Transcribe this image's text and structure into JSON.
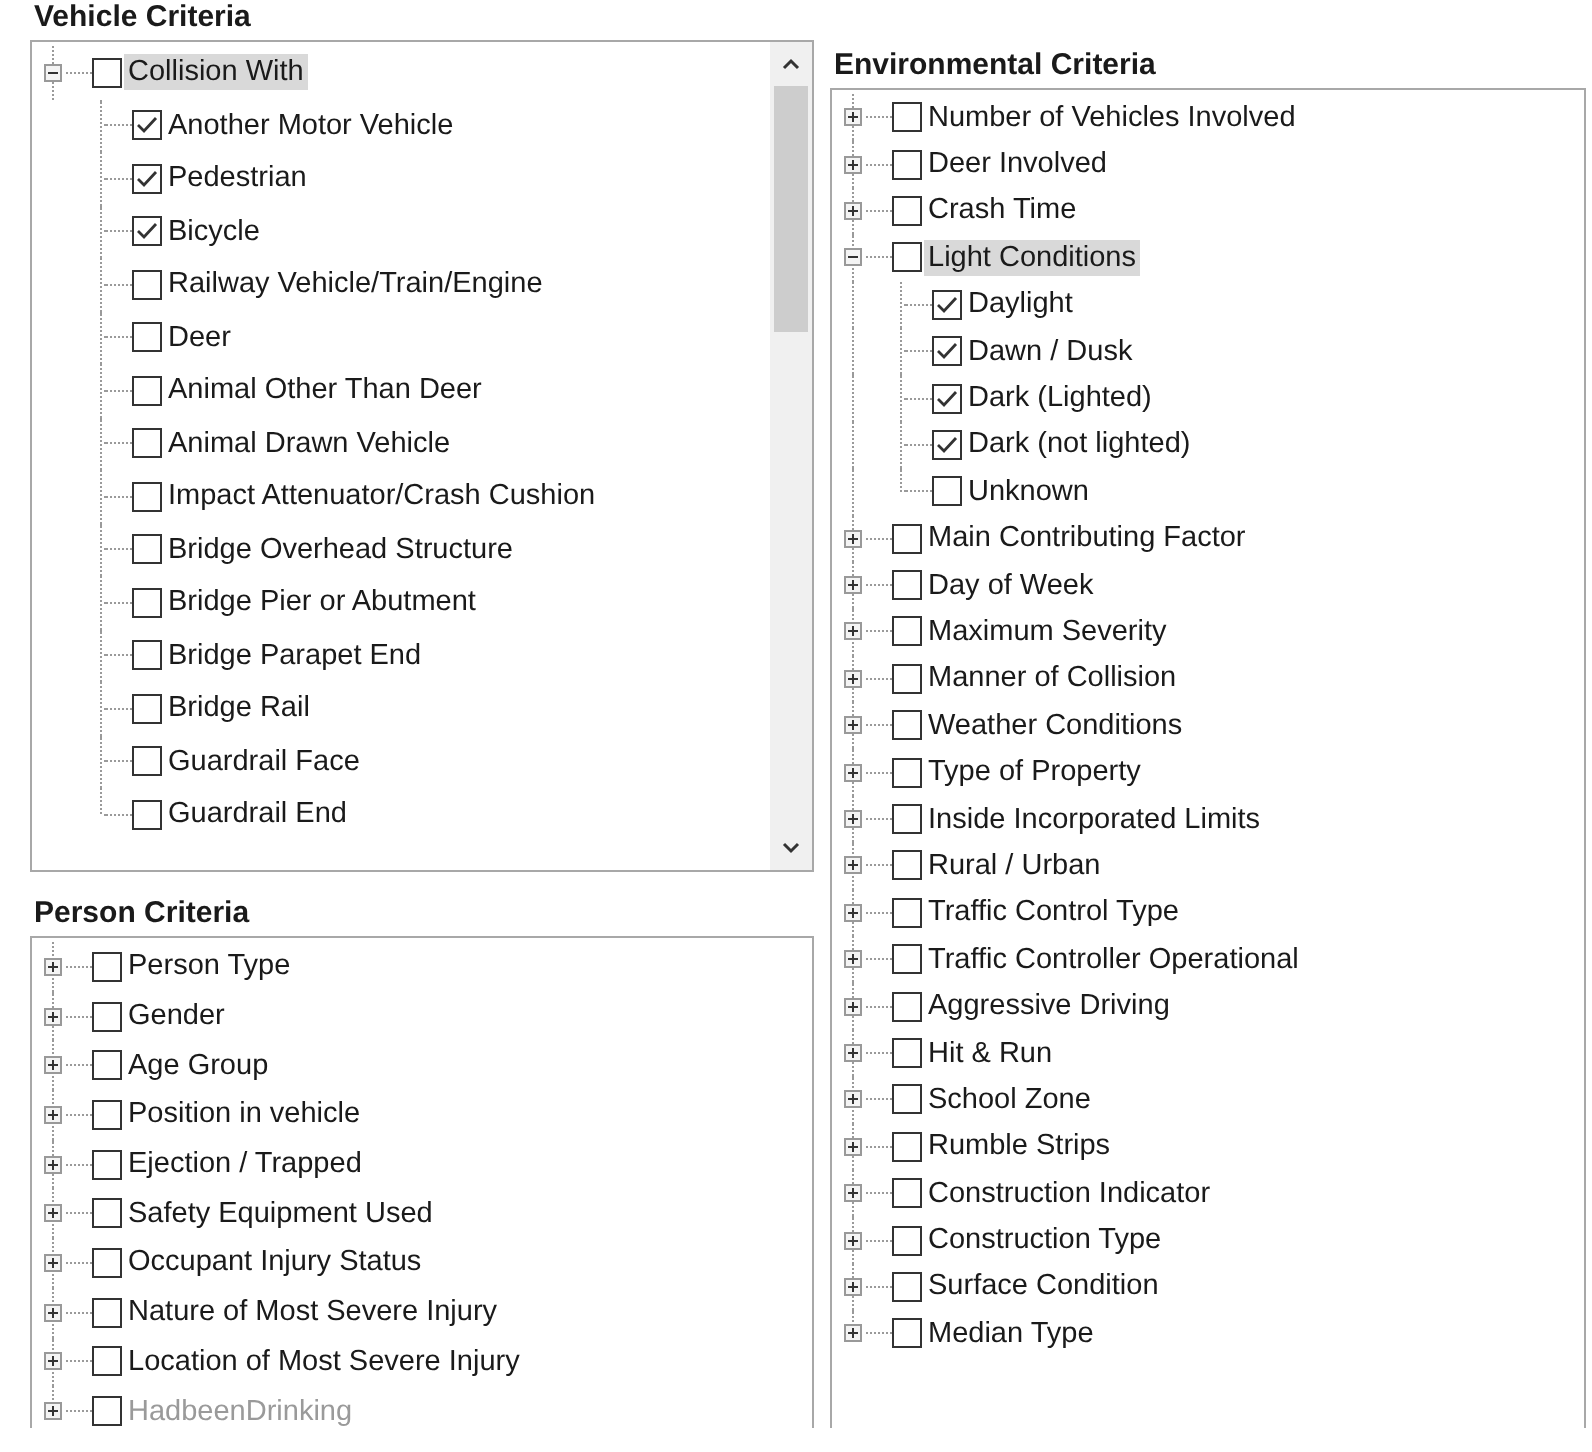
{
  "panels": [
    {
      "title": "Vehicle Criteria",
      "scrollbar": true,
      "items": [
        {
          "label": "Collision With",
          "checked": false,
          "selected": true,
          "expanded": true,
          "disabled": false,
          "children": [
            {
              "label": "Another Motor Vehicle",
              "checked": true
            },
            {
              "label": "Pedestrian",
              "checked": true
            },
            {
              "label": "Bicycle",
              "checked": true
            },
            {
              "label": "Railway Vehicle/Train/Engine",
              "checked": false
            },
            {
              "label": "Deer",
              "checked": false
            },
            {
              "label": "Animal Other Than Deer",
              "checked": false
            },
            {
              "label": "Animal Drawn Vehicle",
              "checked": false
            },
            {
              "label": "Impact Attenuator/Crash Cushion",
              "checked": false
            },
            {
              "label": "Bridge Overhead Structure",
              "checked": false
            },
            {
              "label": "Bridge Pier or Abutment",
              "checked": false
            },
            {
              "label": "Bridge Parapet End",
              "checked": false
            },
            {
              "label": "Bridge Rail",
              "checked": false
            },
            {
              "label": "Guardrail Face",
              "checked": false
            },
            {
              "label": "Guardrail End",
              "checked": false
            }
          ]
        }
      ]
    },
    {
      "title": "Person Criteria",
      "scrollbar": false,
      "items": [
        {
          "label": "Person Type",
          "checked": false,
          "selected": false,
          "expanded": false,
          "disabled": false
        },
        {
          "label": "Gender",
          "checked": false,
          "selected": false,
          "expanded": false,
          "disabled": false
        },
        {
          "label": "Age Group",
          "checked": false,
          "selected": false,
          "expanded": false,
          "disabled": false
        },
        {
          "label": "Position in vehicle",
          "checked": false,
          "selected": false,
          "expanded": false,
          "disabled": false
        },
        {
          "label": "Ejection / Trapped",
          "checked": false,
          "selected": false,
          "expanded": false,
          "disabled": false
        },
        {
          "label": "Safety Equipment Used",
          "checked": false,
          "selected": false,
          "expanded": false,
          "disabled": false
        },
        {
          "label": "Occupant Injury Status",
          "checked": false,
          "selected": false,
          "expanded": false,
          "disabled": false
        },
        {
          "label": "Nature of Most Severe Injury",
          "checked": false,
          "selected": false,
          "expanded": false,
          "disabled": false
        },
        {
          "label": "Location of Most Severe Injury",
          "checked": false,
          "selected": false,
          "expanded": false,
          "disabled": false
        },
        {
          "label": "HadbeenDrinking",
          "checked": false,
          "selected": false,
          "expanded": false,
          "disabled": true
        }
      ]
    },
    {
      "title": "Environmental Criteria",
      "scrollbar": false,
      "items": [
        {
          "label": "Number of Vehicles Involved",
          "checked": false,
          "selected": false,
          "expanded": false,
          "disabled": false
        },
        {
          "label": "Deer Involved",
          "checked": false,
          "selected": false,
          "expanded": false,
          "disabled": false
        },
        {
          "label": "Crash Time",
          "checked": false,
          "selected": false,
          "expanded": false,
          "disabled": false
        },
        {
          "label": "Light Conditions",
          "checked": false,
          "selected": true,
          "expanded": true,
          "disabled": false,
          "children": [
            {
              "label": "Daylight",
              "checked": true
            },
            {
              "label": "Dawn / Dusk",
              "checked": true
            },
            {
              "label": "Dark (Lighted)",
              "checked": true
            },
            {
              "label": "Dark (not lighted)",
              "checked": true
            },
            {
              "label": "Unknown",
              "checked": false
            }
          ]
        },
        {
          "label": "Main Contributing Factor",
          "checked": false,
          "selected": false,
          "expanded": false,
          "disabled": false
        },
        {
          "label": "Day of Week",
          "checked": false,
          "selected": false,
          "expanded": false,
          "disabled": false
        },
        {
          "label": "Maximum Severity",
          "checked": false,
          "selected": false,
          "expanded": false,
          "disabled": false
        },
        {
          "label": "Manner of Collision",
          "checked": false,
          "selected": false,
          "expanded": false,
          "disabled": false
        },
        {
          "label": "Weather Conditions",
          "checked": false,
          "selected": false,
          "expanded": false,
          "disabled": false
        },
        {
          "label": "Type  of Property",
          "checked": false,
          "selected": false,
          "expanded": false,
          "disabled": false
        },
        {
          "label": "Inside Incorporated Limits",
          "checked": false,
          "selected": false,
          "expanded": false,
          "disabled": false
        },
        {
          "label": "Rural / Urban",
          "checked": false,
          "selected": false,
          "expanded": false,
          "disabled": false
        },
        {
          "label": "Traffic Control Type",
          "checked": false,
          "selected": false,
          "expanded": false,
          "disabled": false
        },
        {
          "label": "Traffic Controller Operational",
          "checked": false,
          "selected": false,
          "expanded": false,
          "disabled": false
        },
        {
          "label": "Aggressive Driving",
          "checked": false,
          "selected": false,
          "expanded": false,
          "disabled": false
        },
        {
          "label": "Hit & Run",
          "checked": false,
          "selected": false,
          "expanded": false,
          "disabled": false
        },
        {
          "label": "School Zone",
          "checked": false,
          "selected": false,
          "expanded": false,
          "disabled": false
        },
        {
          "label": "Rumble Strips",
          "checked": false,
          "selected": false,
          "expanded": false,
          "disabled": false
        },
        {
          "label": "Construction Indicator",
          "checked": false,
          "selected": false,
          "expanded": false,
          "disabled": false
        },
        {
          "label": "Construction Type",
          "checked": false,
          "selected": false,
          "expanded": false,
          "disabled": false
        },
        {
          "label": "Surface Condition",
          "checked": false,
          "selected": false,
          "expanded": false,
          "disabled": false
        },
        {
          "label": "Median Type",
          "checked": false,
          "selected": false,
          "expanded": false,
          "disabled": false
        }
      ]
    }
  ]
}
